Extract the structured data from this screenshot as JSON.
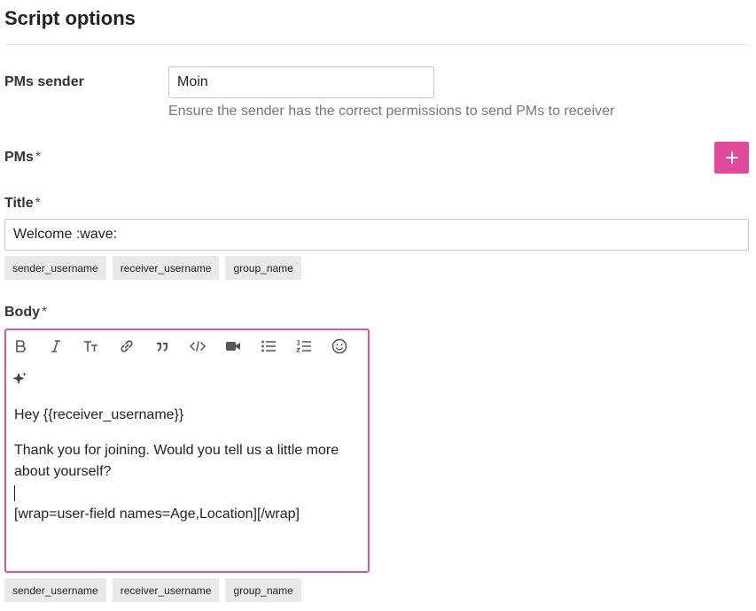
{
  "page": {
    "title": "Script options"
  },
  "pms_sender": {
    "label": "PMs sender",
    "value": "Moin",
    "hint": "Ensure the sender has the correct permissions to send PMs to receiver"
  },
  "pms": {
    "label": "PMs",
    "required_mark": "*",
    "add_icon": "plus-icon",
    "accent": "#e04a9b"
  },
  "title_field": {
    "label": "Title",
    "required_mark": "*",
    "value": "Welcome :wave:",
    "placeholders": [
      "sender_username",
      "receiver_username",
      "group_name"
    ]
  },
  "body_field": {
    "label": "Body",
    "required_mark": "*",
    "toolbar": [
      "bold-icon",
      "italic-icon",
      "heading-icon",
      "link-icon",
      "quote-icon",
      "code-icon",
      "video-icon",
      "bullet-list-icon",
      "numbered-list-icon",
      "emoji-icon",
      "sparkle-icon"
    ],
    "lines": {
      "line1": "Hey {{receiver_username}}",
      "line2": "Thank you for joining. Would you tell us a little more about yourself?",
      "line3": "[wrap=user-field names=Age,Location][/wrap]"
    },
    "placeholders": [
      "sender_username",
      "receiver_username",
      "group_name"
    ],
    "border_color": "#d6579f"
  }
}
